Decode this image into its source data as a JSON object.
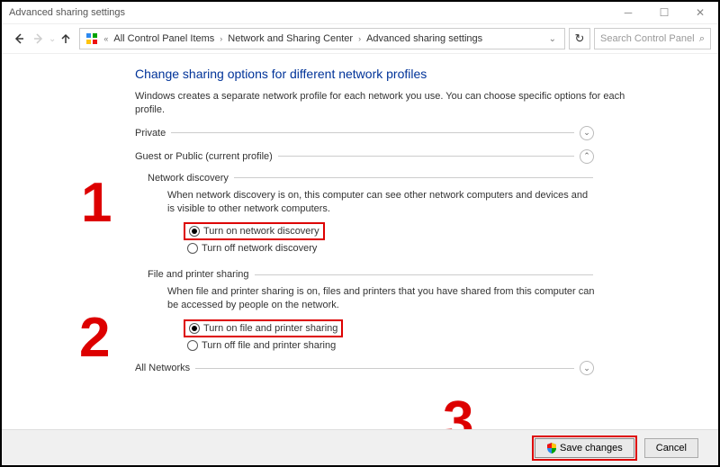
{
  "win": {
    "title": "Advanced sharing settings"
  },
  "nav": {
    "crumbs": [
      "All Control Panel Items",
      "Network and Sharing Center",
      "Advanced sharing settings"
    ]
  },
  "search": {
    "placeholder": "Search Control Panel"
  },
  "page": {
    "heading": "Change sharing options for different network profiles",
    "intro": "Windows creates a separate network profile for each network you use. You can choose specific options for each profile."
  },
  "profiles": {
    "private": "Private",
    "guest": "Guest or Public (current profile)",
    "all": "All Networks"
  },
  "discovery": {
    "group": "Network discovery",
    "desc": "When network discovery is on, this computer can see other network computers and devices and is visible to other network computers.",
    "on": "Turn on network discovery",
    "off": "Turn off network discovery"
  },
  "fps": {
    "group": "File and printer sharing",
    "desc": "When file and printer sharing is on, files and printers that you have shared from this computer can be accessed by people on the network.",
    "on": "Turn on file and printer sharing",
    "off": "Turn off file and printer sharing"
  },
  "buttons": {
    "save": "Save changes",
    "cancel": "Cancel"
  },
  "annotations": {
    "one": "1",
    "two": "2",
    "three": "3"
  }
}
